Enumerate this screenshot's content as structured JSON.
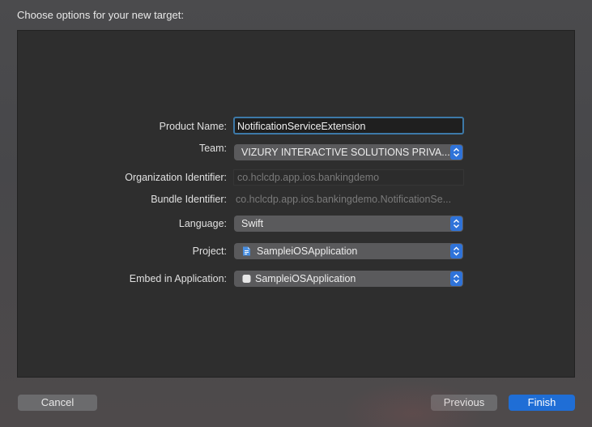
{
  "dialog": {
    "title": "Choose options for your new target:"
  },
  "form": {
    "product_name": {
      "label": "Product Name:",
      "value": "NotificationServiceExtension"
    },
    "team": {
      "label": "Team:",
      "value": "VIZURY INTERACTIVE SOLUTIONS PRIVA..."
    },
    "organization_identifier": {
      "label": "Organization Identifier:",
      "value": "co.hclcdp.app.ios.bankingdemo"
    },
    "bundle_identifier": {
      "label": "Bundle Identifier:",
      "value": "co.hclcdp.app.ios.bankingdemo.NotificationSe..."
    },
    "language": {
      "label": "Language:",
      "value": "Swift"
    },
    "project": {
      "label": "Project:",
      "value": "SampleiOSApplication",
      "icon": "project-file-icon"
    },
    "embed_in_application": {
      "label": "Embed in Application:",
      "value": "SampleiOSApplication",
      "icon": "app-icon"
    }
  },
  "buttons": {
    "cancel": "Cancel",
    "previous": "Previous",
    "finish": "Finish"
  },
  "colors": {
    "accent": "#1f6ed6",
    "focus_ring": "#3d79a8",
    "stepper": "#2f73d9"
  }
}
